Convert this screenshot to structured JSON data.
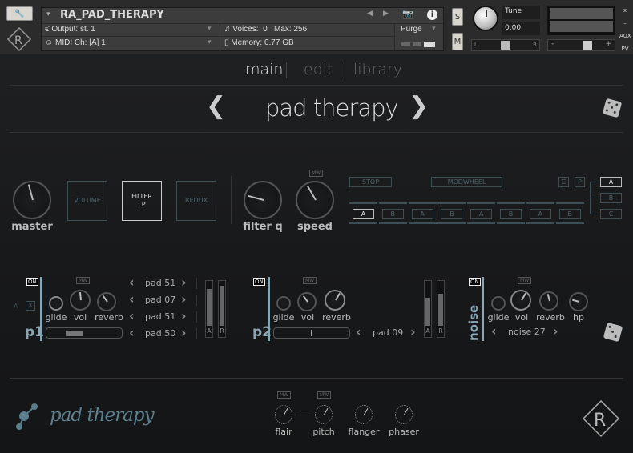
{
  "header": {
    "instrument_name": "RA_PAD_THERAPY",
    "output_label": "Output:",
    "output_value": "st. 1",
    "midi_label": "MIDI Ch:",
    "midi_value": "[A]  1",
    "voices_label": "Voices:",
    "voices_value": "0",
    "max_label": "Max:",
    "max_value": "256",
    "memory_label": "Memory:",
    "memory_value": "0.77 GB",
    "purge_label": "Purge",
    "solo_label": "S",
    "mute_label": "M",
    "tune_label": "Tune",
    "tune_value": "0.00",
    "pan_left": "L",
    "pan_right": "R",
    "vol_minus": "-",
    "vol_plus": "+",
    "close_label": "x",
    "minimize_label": "–",
    "aux_label": "AUX",
    "pv_label": "PV"
  },
  "tabs": [
    {
      "label": "main",
      "active": true
    },
    {
      "label": "edit",
      "active": false
    },
    {
      "label": "library",
      "active": false
    }
  ],
  "preset": {
    "name": "pad therapy"
  },
  "controls": {
    "master": {
      "label": "master",
      "value": 0.45
    },
    "filter_types": [
      {
        "label": "VOLUME",
        "active": false
      },
      {
        "label": "FILTER\nLP",
        "active": true
      },
      {
        "label": "REDUX",
        "active": false
      }
    ],
    "filter_q": {
      "label": "filter q",
      "value": 0.25
    },
    "speed": {
      "label": "speed",
      "value": 0.4
    },
    "mw": "MW",
    "stop_label": "STOP",
    "modwheel_label": "MODWHEEL",
    "c_label": "C",
    "p_label": "P",
    "sequence": [
      "A",
      "B",
      "A",
      "B",
      "A",
      "B",
      "A",
      "B"
    ],
    "abc": [
      "A",
      "B",
      "C"
    ]
  },
  "p1": {
    "label": "p1",
    "on": "ON",
    "a": "A",
    "x": "X",
    "glide": "glide",
    "vol": "vol",
    "reverb": "reverb",
    "vol_value": 0.48,
    "reverb_value": 0.38,
    "pads": [
      "pad 51",
      "pad 07",
      "pad 51",
      "pad 50"
    ],
    "meter_a": "A",
    "meter_r": "R",
    "meter_a_level": 0.85,
    "meter_r_level": 0.92
  },
  "p2": {
    "label": "p2",
    "on": "ON",
    "glide": "glide",
    "vol": "vol",
    "reverb": "reverb",
    "vol_value": 0.38,
    "reverb_value": 0.6,
    "pad": "pad 09",
    "meter_a": "A",
    "meter_r": "R",
    "meter_a_level": 0.65,
    "meter_r_level": 0.75
  },
  "noise": {
    "label": "noise",
    "on": "ON",
    "glide": "glide",
    "vol": "vol",
    "reverb": "reverb",
    "hp": "hp",
    "vol_value": 0.6,
    "reverb_value": 0.45,
    "hp_value": 0.25,
    "preset": "noise 27"
  },
  "fx": [
    {
      "label": "flair",
      "mw": "MW"
    },
    {
      "label": "pitch",
      "mw": "MW"
    },
    {
      "label": "flanger"
    },
    {
      "label": "phaser"
    }
  ],
  "logo_text": "pad therapy"
}
